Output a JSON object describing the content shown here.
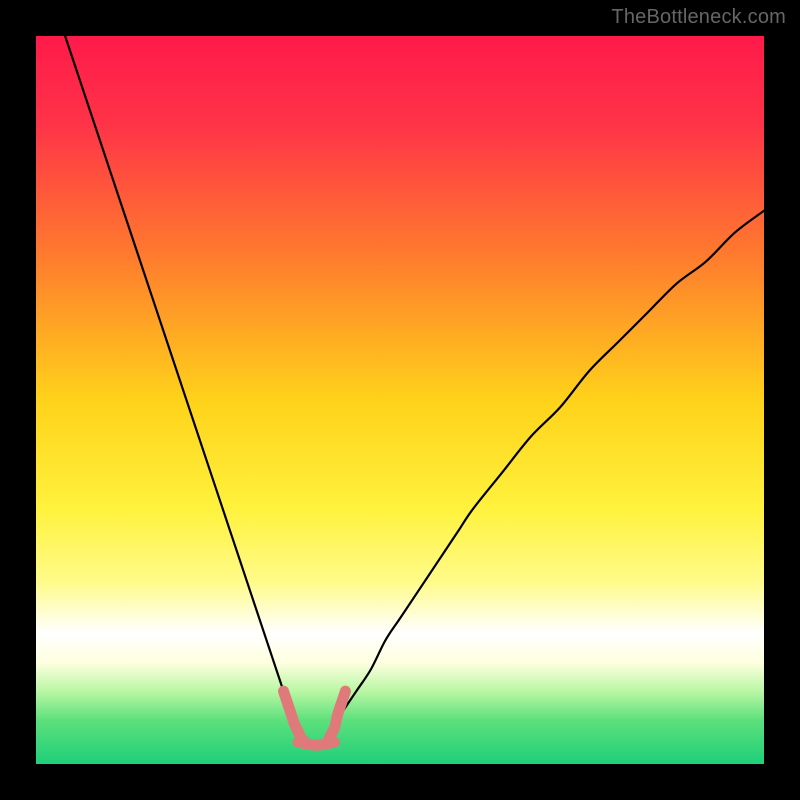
{
  "watermark": "TheBottleneck.com",
  "palette": {
    "background": "#000000",
    "curve_stroke": "#000000",
    "accent_stroke": "#e07a7a",
    "gradient_stops": [
      {
        "pct": 0,
        "color": "#ff1a4a"
      },
      {
        "pct": 12,
        "color": "#ff3348"
      },
      {
        "pct": 30,
        "color": "#ff7a2e"
      },
      {
        "pct": 50,
        "color": "#ffd21a"
      },
      {
        "pct": 65,
        "color": "#fff23d"
      },
      {
        "pct": 75,
        "color": "#fffb8a"
      },
      {
        "pct": 82,
        "color": "#ffffff"
      },
      {
        "pct": 86,
        "color": "#ffffe0"
      },
      {
        "pct": 90,
        "color": "#b9f7a4"
      },
      {
        "pct": 94,
        "color": "#5de07c"
      },
      {
        "pct": 100,
        "color": "#1ecf7a"
      }
    ]
  },
  "chart_data": {
    "type": "line",
    "title": "",
    "xlabel": "",
    "ylabel": "",
    "xlim": [
      0,
      100
    ],
    "ylim": [
      0,
      100
    ],
    "grid": false,
    "legend": null,
    "series": [
      {
        "name": "left_branch",
        "x": [
          4,
          6,
          8,
          10,
          12,
          14,
          16,
          18,
          20,
          22,
          24,
          26,
          27,
          28,
          29,
          30,
          31,
          32,
          33,
          34,
          35,
          36,
          37
        ],
        "values": [
          100,
          94,
          88,
          82,
          76,
          70,
          64,
          58,
          52,
          46,
          40,
          34,
          31,
          28,
          25,
          22,
          19,
          16,
          13,
          10,
          7,
          4,
          3
        ]
      },
      {
        "name": "right_branch",
        "x": [
          40,
          41,
          42,
          44,
          46,
          48,
          50,
          52,
          54,
          56,
          58,
          60,
          64,
          68,
          72,
          76,
          80,
          84,
          88,
          92,
          96,
          100
        ],
        "values": [
          3,
          5,
          7,
          10,
          13,
          17,
          20,
          23,
          26,
          29,
          32,
          35,
          40,
          45,
          49,
          54,
          58,
          62,
          66,
          69,
          73,
          76
        ]
      }
    ],
    "annotations": [
      {
        "name": "accent_segment_left",
        "x": [
          34,
          35,
          35.5,
          36,
          36.5,
          37
        ],
        "values": [
          10,
          7,
          5.5,
          4.5,
          3.5,
          3
        ]
      },
      {
        "name": "accent_segment_bottom",
        "x": [
          36,
          37,
          38,
          39,
          40,
          41
        ],
        "values": [
          3,
          2.8,
          2.6,
          2.6,
          2.8,
          3
        ]
      },
      {
        "name": "accent_segment_right",
        "x": [
          40,
          40.5,
          41,
          41.5,
          42,
          42.5
        ],
        "values": [
          3,
          4,
          5,
          7,
          8.5,
          10
        ]
      }
    ]
  }
}
